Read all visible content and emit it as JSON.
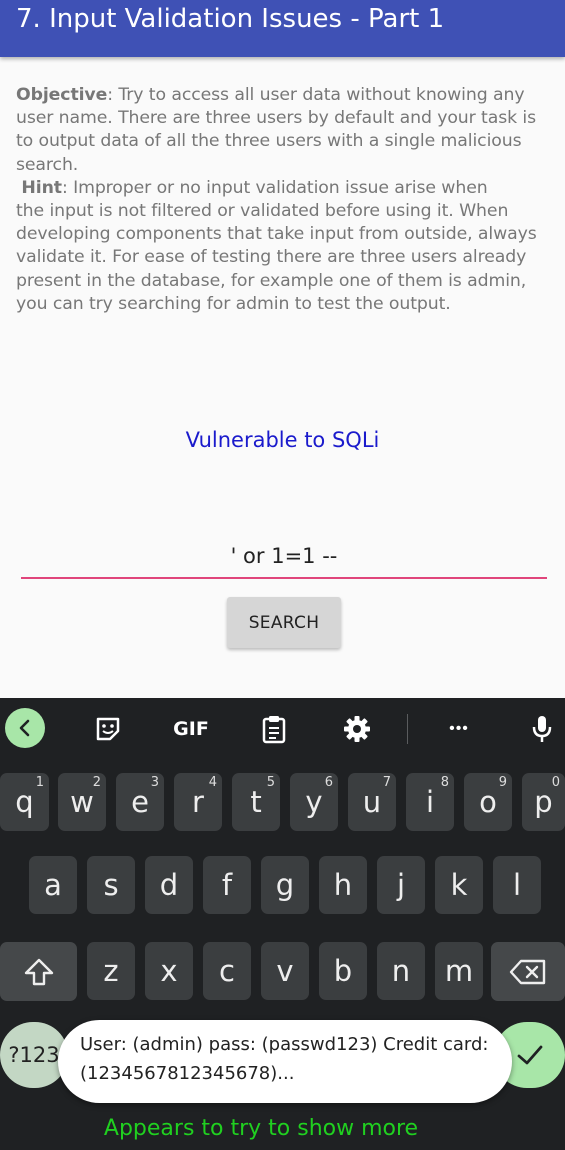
{
  "appbar": {
    "title": "7. Input Validation Issues - Part 1",
    "color": "#3f51b5"
  },
  "description": {
    "objective_label": "Objective",
    "objective_text": [
      ": Try to access all user data without knowing any",
      "user name. There are three users by default and your task is",
      "to output data of all the three users with a single malicious",
      "search."
    ],
    "hint_label": "Hint",
    "hint_text": [
      ": Improper or no input validation issue arise when",
      "the input is not filtered or validated before using it. When",
      "developing components that take input from outside, always",
      "validate it. For ease of testing there are three users already",
      "present in the database, for example one of them is admin,",
      "you can try searching for admin to test the output."
    ]
  },
  "vuln_label": "Vulnerable to SQLi",
  "search_input": {
    "value": "' or 1=1 --"
  },
  "search_button": {
    "label": "SEARCH"
  },
  "keyboard": {
    "toolbar": {
      "gif": "GIF",
      "more": "•••"
    },
    "row1": [
      {
        "k": "q",
        "h": "1"
      },
      {
        "k": "w",
        "h": "2"
      },
      {
        "k": "e",
        "h": "3"
      },
      {
        "k": "r",
        "h": "4"
      },
      {
        "k": "t",
        "h": "5"
      },
      {
        "k": "y",
        "h": "6"
      },
      {
        "k": "u",
        "h": "7"
      },
      {
        "k": "i",
        "h": "8"
      },
      {
        "k": "o",
        "h": "9"
      },
      {
        "k": "p",
        "h": "0"
      }
    ],
    "row2": [
      "a",
      "s",
      "d",
      "f",
      "g",
      "h",
      "j",
      "k",
      "l"
    ],
    "row3": [
      "z",
      "x",
      "c",
      "v",
      "b",
      "n",
      "m"
    ],
    "sym_label": "?123"
  },
  "toast": {
    "line1": "User: (admin) pass: (passwd123) Credit card:",
    "line2": "(1234567812345678)..."
  },
  "annotation": "Appears to try to show more"
}
